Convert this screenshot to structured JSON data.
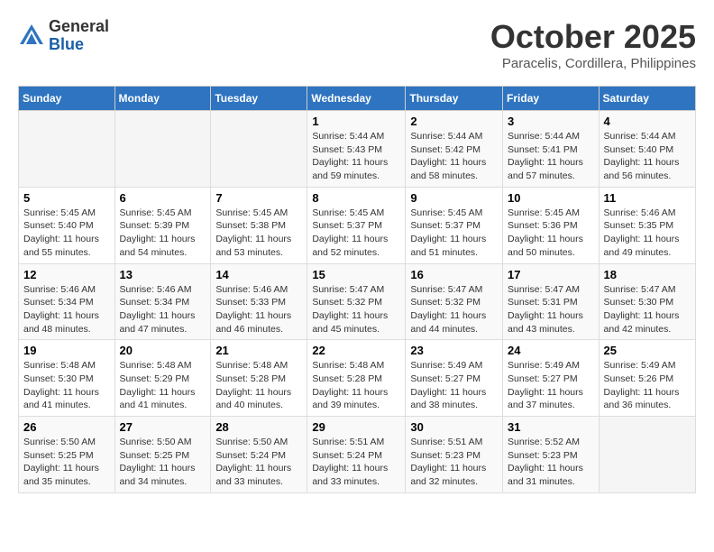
{
  "logo": {
    "general": "General",
    "blue": "Blue"
  },
  "title": "October 2025",
  "location": "Paracelis, Cordillera, Philippines",
  "days_of_week": [
    "Sunday",
    "Monday",
    "Tuesday",
    "Wednesday",
    "Thursday",
    "Friday",
    "Saturday"
  ],
  "weeks": [
    [
      {
        "day": "",
        "info": ""
      },
      {
        "day": "",
        "info": ""
      },
      {
        "day": "",
        "info": ""
      },
      {
        "day": "1",
        "info": "Sunrise: 5:44 AM\nSunset: 5:43 PM\nDaylight: 11 hours and 59 minutes."
      },
      {
        "day": "2",
        "info": "Sunrise: 5:44 AM\nSunset: 5:42 PM\nDaylight: 11 hours and 58 minutes."
      },
      {
        "day": "3",
        "info": "Sunrise: 5:44 AM\nSunset: 5:41 PM\nDaylight: 11 hours and 57 minutes."
      },
      {
        "day": "4",
        "info": "Sunrise: 5:44 AM\nSunset: 5:40 PM\nDaylight: 11 hours and 56 minutes."
      }
    ],
    [
      {
        "day": "5",
        "info": "Sunrise: 5:45 AM\nSunset: 5:40 PM\nDaylight: 11 hours and 55 minutes."
      },
      {
        "day": "6",
        "info": "Sunrise: 5:45 AM\nSunset: 5:39 PM\nDaylight: 11 hours and 54 minutes."
      },
      {
        "day": "7",
        "info": "Sunrise: 5:45 AM\nSunset: 5:38 PM\nDaylight: 11 hours and 53 minutes."
      },
      {
        "day": "8",
        "info": "Sunrise: 5:45 AM\nSunset: 5:37 PM\nDaylight: 11 hours and 52 minutes."
      },
      {
        "day": "9",
        "info": "Sunrise: 5:45 AM\nSunset: 5:37 PM\nDaylight: 11 hours and 51 minutes."
      },
      {
        "day": "10",
        "info": "Sunrise: 5:45 AM\nSunset: 5:36 PM\nDaylight: 11 hours and 50 minutes."
      },
      {
        "day": "11",
        "info": "Sunrise: 5:46 AM\nSunset: 5:35 PM\nDaylight: 11 hours and 49 minutes."
      }
    ],
    [
      {
        "day": "12",
        "info": "Sunrise: 5:46 AM\nSunset: 5:34 PM\nDaylight: 11 hours and 48 minutes."
      },
      {
        "day": "13",
        "info": "Sunrise: 5:46 AM\nSunset: 5:34 PM\nDaylight: 11 hours and 47 minutes."
      },
      {
        "day": "14",
        "info": "Sunrise: 5:46 AM\nSunset: 5:33 PM\nDaylight: 11 hours and 46 minutes."
      },
      {
        "day": "15",
        "info": "Sunrise: 5:47 AM\nSunset: 5:32 PM\nDaylight: 11 hours and 45 minutes."
      },
      {
        "day": "16",
        "info": "Sunrise: 5:47 AM\nSunset: 5:32 PM\nDaylight: 11 hours and 44 minutes."
      },
      {
        "day": "17",
        "info": "Sunrise: 5:47 AM\nSunset: 5:31 PM\nDaylight: 11 hours and 43 minutes."
      },
      {
        "day": "18",
        "info": "Sunrise: 5:47 AM\nSunset: 5:30 PM\nDaylight: 11 hours and 42 minutes."
      }
    ],
    [
      {
        "day": "19",
        "info": "Sunrise: 5:48 AM\nSunset: 5:30 PM\nDaylight: 11 hours and 41 minutes."
      },
      {
        "day": "20",
        "info": "Sunrise: 5:48 AM\nSunset: 5:29 PM\nDaylight: 11 hours and 41 minutes."
      },
      {
        "day": "21",
        "info": "Sunrise: 5:48 AM\nSunset: 5:28 PM\nDaylight: 11 hours and 40 minutes."
      },
      {
        "day": "22",
        "info": "Sunrise: 5:48 AM\nSunset: 5:28 PM\nDaylight: 11 hours and 39 minutes."
      },
      {
        "day": "23",
        "info": "Sunrise: 5:49 AM\nSunset: 5:27 PM\nDaylight: 11 hours and 38 minutes."
      },
      {
        "day": "24",
        "info": "Sunrise: 5:49 AM\nSunset: 5:27 PM\nDaylight: 11 hours and 37 minutes."
      },
      {
        "day": "25",
        "info": "Sunrise: 5:49 AM\nSunset: 5:26 PM\nDaylight: 11 hours and 36 minutes."
      }
    ],
    [
      {
        "day": "26",
        "info": "Sunrise: 5:50 AM\nSunset: 5:25 PM\nDaylight: 11 hours and 35 minutes."
      },
      {
        "day": "27",
        "info": "Sunrise: 5:50 AM\nSunset: 5:25 PM\nDaylight: 11 hours and 34 minutes."
      },
      {
        "day": "28",
        "info": "Sunrise: 5:50 AM\nSunset: 5:24 PM\nDaylight: 11 hours and 33 minutes."
      },
      {
        "day": "29",
        "info": "Sunrise: 5:51 AM\nSunset: 5:24 PM\nDaylight: 11 hours and 33 minutes."
      },
      {
        "day": "30",
        "info": "Sunrise: 5:51 AM\nSunset: 5:23 PM\nDaylight: 11 hours and 32 minutes."
      },
      {
        "day": "31",
        "info": "Sunrise: 5:52 AM\nSunset: 5:23 PM\nDaylight: 11 hours and 31 minutes."
      },
      {
        "day": "",
        "info": ""
      }
    ]
  ]
}
